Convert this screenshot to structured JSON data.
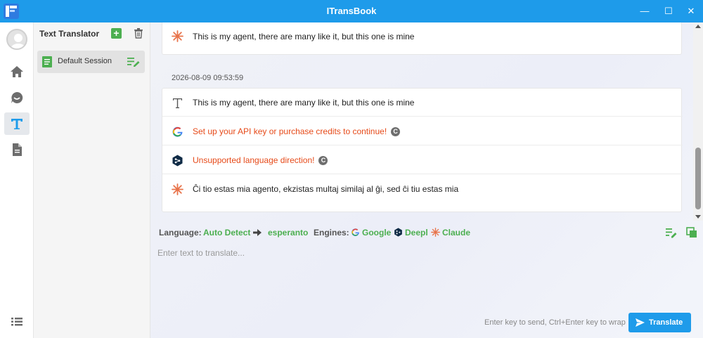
{
  "window": {
    "title": "ITransBook",
    "minimize": "—",
    "maximize": "☐",
    "close": "✕"
  },
  "colors": {
    "accent": "#1e9bea",
    "green": "#4caf50",
    "error": "#e64a19",
    "claude": "#e8734a"
  },
  "rail": {
    "items": [
      {
        "name": "home-icon",
        "active": false
      },
      {
        "name": "chat-icon",
        "active": false
      },
      {
        "name": "text-translator-icon",
        "active": true
      },
      {
        "name": "document-icon",
        "active": false
      }
    ],
    "bottom_icon": "list-icon"
  },
  "sidebar": {
    "title": "Text Translator",
    "add_icon": "+",
    "sessions": [
      {
        "label": "Default Session",
        "selected": true
      }
    ]
  },
  "chat": {
    "partial_message": {
      "engine": "claude",
      "text": "This is my agent, there are many like it, but this one is mine"
    },
    "timestamp": "2026-08-09 09:53:59",
    "rows": [
      {
        "engine": "source-text",
        "text": "This is my agent, there are many like it, but this one is mine",
        "error": false
      },
      {
        "engine": "google",
        "text": "Set up your API key or purchase credits to continue!",
        "error": true
      },
      {
        "engine": "deepl",
        "text": "Unsupported language direction!",
        "error": true
      },
      {
        "engine": "claude",
        "text": "Ĉi tio estas mia agento, ekzistas multaj similaj al ĝi, sed ĉi tiu estas mia",
        "error": false
      }
    ],
    "retry_icon": "C"
  },
  "infobar": {
    "language_label": "Language:",
    "source_lang": "Auto Detect",
    "target_lang": "esperanto",
    "engines_label": "Engines:",
    "engines": [
      "Google",
      "Deepl",
      "Claude"
    ]
  },
  "input": {
    "placeholder": "Enter text to translate...",
    "hint": "Enter key to send, Ctrl+Enter key to wrap",
    "translate_label": "Translate"
  }
}
